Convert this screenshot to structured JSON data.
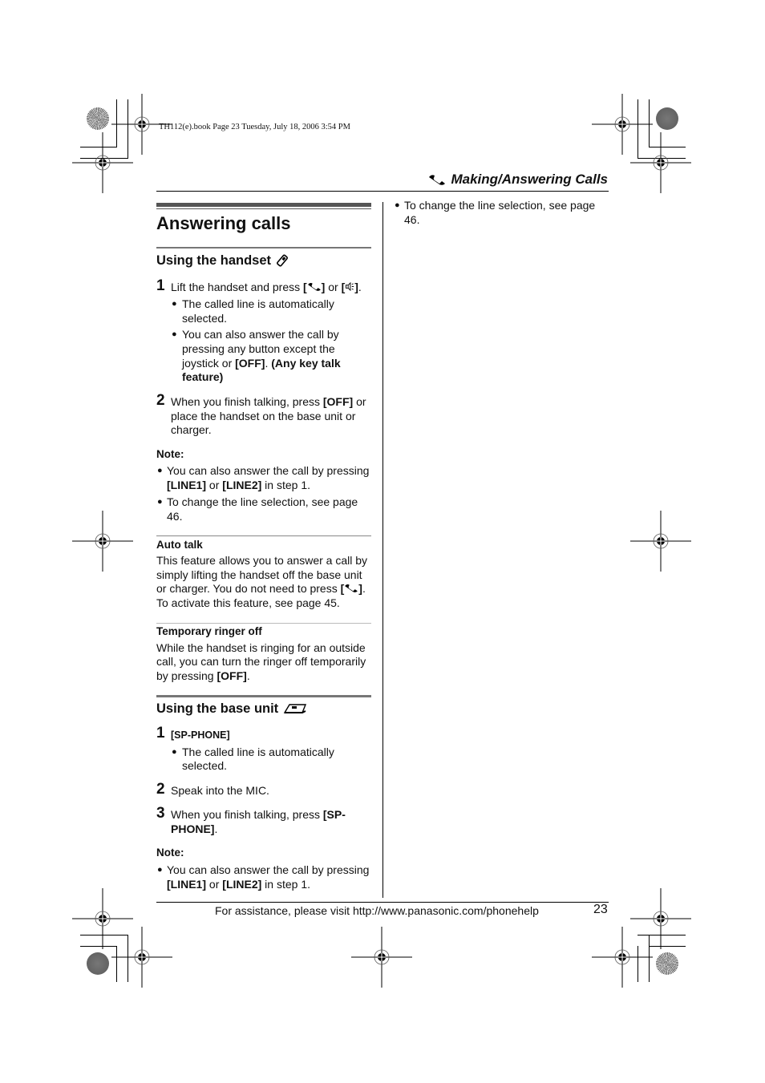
{
  "book_info": "TH112(e).book  Page 23  Tuesday, July 18, 2006  3:54 PM",
  "running_head": {
    "icon": "phone-handset-icon",
    "title": "Making/Answering Calls"
  },
  "section_title": "Answering calls",
  "handset": {
    "heading": "Using the handset",
    "heading_icon": "handset-icon",
    "step1": {
      "number": "1",
      "text_a": "Lift the handset and press ",
      "key_talk_icon": "talk-key-icon",
      "text_or": " or ",
      "key_speaker_icon": "speaker-key-icon",
      "text_end": ".",
      "bullets": [
        [
          "The called line is automatically",
          "selected."
        ],
        [
          "You can also answer the call by",
          "pressing any button except the",
          "joystick or ",
          "OFF",
          ". ",
          "(Any key talk",
          "feature)"
        ]
      ]
    },
    "step2": {
      "number": "2",
      "line1_a": "When you finish talking, press ",
      "line1_key": "OFF",
      "line1_b": " or",
      "line2": "place the handset on the base unit or",
      "line3": "charger."
    },
    "note": {
      "label": "Note:",
      "bullet1_line1": "You can also answer the call by pressing",
      "bullet1_key1": "LINE1",
      "bullet1_or": " or ",
      "bullet1_key2": "LINE2",
      "bullet1_end": " in step 1.",
      "bullet2_line1": "To change the line selection, see page",
      "bullet2_line2": "46."
    }
  },
  "auto_talk": {
    "heading": "Auto talk",
    "lines": [
      "This feature allows you to answer a call by",
      "simply lifting the handset off the base unit",
      "or charger. You do not need to press ",
      "To activate this feature, see page 45."
    ],
    "line3_end": "."
  },
  "ringer_off": {
    "heading": "Temporary ringer off",
    "lines": [
      "While the handset is ringing for an outside",
      "call, you can turn the ringer off temporarily",
      "by pressing "
    ],
    "key": "OFF",
    "end": "."
  },
  "base_unit": {
    "heading": "Using the base unit",
    "heading_icon": "base-unit-icon",
    "step1": {
      "number": "1",
      "key": "SP-PHONE",
      "bullet": [
        "The called line is automatically",
        "selected."
      ]
    },
    "step2": {
      "number": "2",
      "text": "Speak into the MIC."
    },
    "step3": {
      "number": "3",
      "text": "When you finish talking, press ",
      "key_a": "SP-",
      "key_b": "PHONE",
      "end": "."
    },
    "note": {
      "label": "Note:",
      "line1": "You can also answer the call by pressing",
      "key1": "LINE1",
      "or": " or ",
      "key2": "LINE2",
      "end": " in step 1."
    }
  },
  "right_column": {
    "bullet_line1": "To change the line selection, see page",
    "bullet_line2": "46."
  },
  "footer": {
    "assist": "For assistance, please visit http://www.panasonic.com/phonehelp",
    "page_number": "23"
  }
}
